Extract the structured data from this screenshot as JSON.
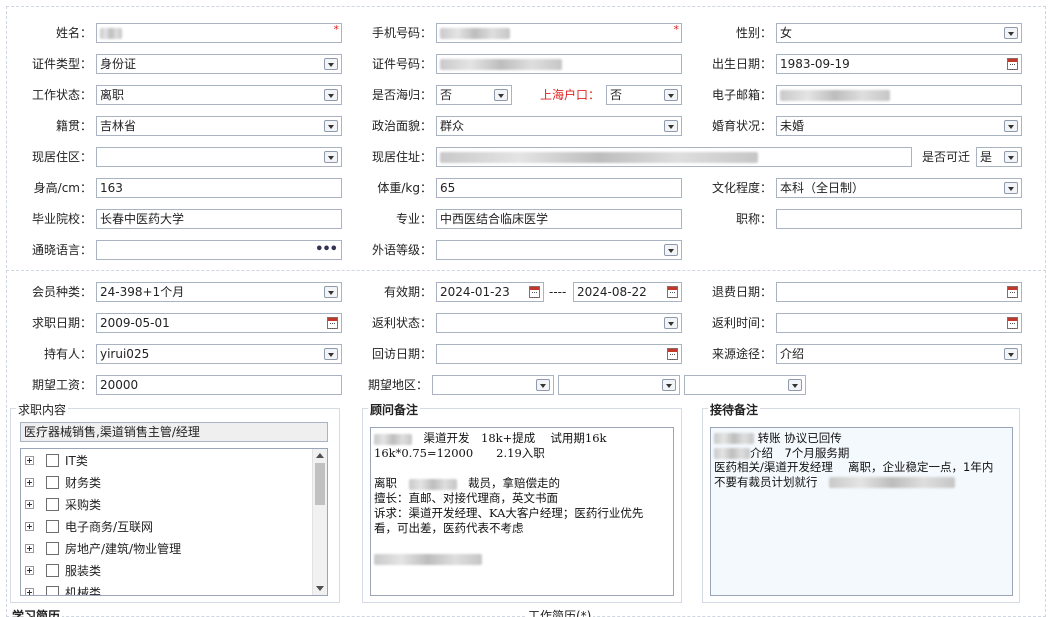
{
  "basic": {
    "name_label": "姓名：",
    "required_mark": "*",
    "phone_label": "手机号码：",
    "gender_label": "性别：",
    "gender_value": "女",
    "id_type_label": "证件类型：",
    "id_type_value": "身份证",
    "id_no_label": "证件号码：",
    "birth_label": "出生日期：",
    "birth_value": "1983-09-19",
    "work_status_label": "工作状态：",
    "work_status_value": "离职",
    "overseas_label": "是否海归：",
    "overseas_value": "否",
    "shanghai_label": "上海户口：",
    "shanghai_value": "否",
    "email_label": "电子邮箱：",
    "native_label": "籍贯：",
    "native_value": "吉林省",
    "political_label": "政治面貌：",
    "political_value": "群众",
    "marital_label": "婚育状况：",
    "marital_value": "未婚",
    "residence_area_label": "现居住区：",
    "address_label": "现居住址：",
    "relocate_label": "是否可迁",
    "relocate_value": "是",
    "height_label": "身高/cm：",
    "height_value": "163",
    "weight_label": "体重/kg：",
    "weight_value": "65",
    "education_label": "文化程度：",
    "education_value": "本科（全日制）",
    "school_label": "毕业院校：",
    "school_value": "长春中医药大学",
    "major_label": "专业：",
    "major_value": "中西医结合临床医学",
    "title_label": "职称：",
    "language_label": "通晓语言：",
    "foreign_label": "外语等级："
  },
  "member": {
    "type_label": "会员种类：",
    "type_value": "24-398+1个月",
    "valid_label": "有效期：",
    "valid_from": "2024-01-23",
    "valid_sep": "----",
    "valid_to": "2024-08-22",
    "refund_date_label": "退费日期：",
    "seek_date_label": "求职日期：",
    "seek_date_value": "2009-05-01",
    "rebate_status_label": "返利状态：",
    "rebate_time_label": "返利时间：",
    "holder_label": "持有人：",
    "holder_value": "yirui025",
    "visit_date_label": "回访日期：",
    "source_label": "来源途径：",
    "source_value": "介绍",
    "salary_label": "期望工资：",
    "salary_value": "20000",
    "region_label": "期望地区："
  },
  "job": {
    "title": "求职内容",
    "selected": "医疗器械销售,渠道销售主管/经理",
    "categories": [
      "IT类",
      "财务类",
      "采购类",
      "电子商务/互联网",
      "房地产/建筑/物业管理",
      "服装类",
      "机械类"
    ]
  },
  "advisor": {
    "title": "顾问备注",
    "line1": "渠道开发　18k+提成　 试用期16k",
    "line2": "16k*0.75=12000　　2.19入职",
    "line3": "离职",
    "line3b": "裁员，拿赔偿走的",
    "line4": "擅长：直邮、对接代理商，英文书面",
    "line5": "诉求：渠道开发经理、KA大客户经理；医药行业优先",
    "line6": "看，可出差，医药代表不考虑"
  },
  "reception": {
    "title": "接待备注",
    "line1": "转账 协议已回传",
    "line2": "介绍　7个月服务期",
    "line3": "医药相关/渠道开发经理　 离职，企业稳定一点，1年内",
    "line4": "不要有裁员计划就行"
  },
  "bottom": {
    "study_label": "学习简历",
    "work_label": "工作简历(*)"
  },
  "colors": {
    "accent_red": "#e02020",
    "border": "#a9b3c2"
  }
}
